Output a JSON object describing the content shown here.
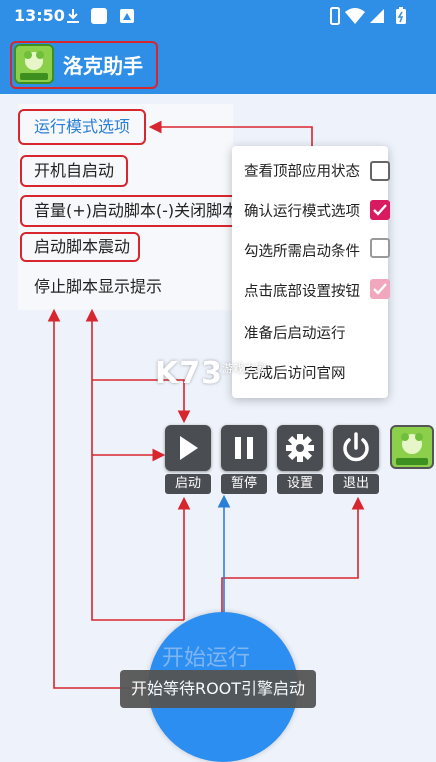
{
  "status_bar": {
    "time": "13:50"
  },
  "app": {
    "title": "洛克助手",
    "logo_icon": "app-logo-icon"
  },
  "menu": {
    "title": "运行模式选项",
    "items": [
      {
        "label": "开机自启动"
      },
      {
        "label": "音量(+)启动脚本(-)关闭脚本"
      },
      {
        "label": "启动脚本震动"
      },
      {
        "label": "停止脚本显示提示"
      }
    ]
  },
  "popup": {
    "items": [
      {
        "label": "查看顶部应用状态",
        "checkbox": "unchecked"
      },
      {
        "label": "确认运行模式选项",
        "checkbox": "checked"
      },
      {
        "label": "勾选所需启动条件",
        "checkbox": "unchecked"
      },
      {
        "label": "点击底部设置按钮",
        "checkbox": "checked-light"
      },
      {
        "label": "准备后启动运行"
      },
      {
        "label": "完成后访问官网"
      }
    ]
  },
  "controls": {
    "start": {
      "label": "启动",
      "icon": "play-icon"
    },
    "pause": {
      "label": "暂停",
      "icon": "pause-icon"
    },
    "settings": {
      "label": "设置",
      "icon": "gear-icon"
    },
    "exit": {
      "label": "退出",
      "icon": "power-icon"
    }
  },
  "start_button": {
    "label": "开始运行"
  },
  "toast": {
    "text": "开始等待ROOT引擎启动"
  },
  "watermark": {
    "text": "K73",
    "sub": "游戏之家"
  },
  "colors": {
    "primary": "#2f8ee6",
    "annotation": "#d8262e",
    "check": "#d81b60"
  }
}
